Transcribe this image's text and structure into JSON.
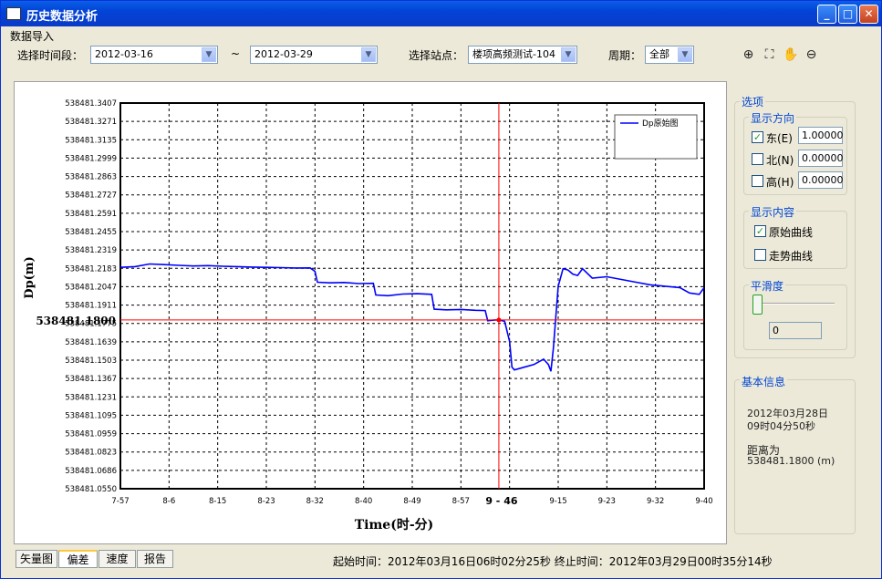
{
  "window": {
    "title": "历史数据分析"
  },
  "menu": {
    "data_import": "数据导入"
  },
  "toolbar": {
    "time_range_label": "选择时间段：",
    "start_date": "2012-03-16",
    "tilde": "~",
    "end_date": "2012-03-29",
    "station_label": "选择站点：",
    "station_value": "楼项高频测试-104",
    "period_label": "周期：",
    "period_value": "全部"
  },
  "options": {
    "title": "选项",
    "direction": {
      "title": "显示方向",
      "east": {
        "label": "东(E)",
        "checked": true,
        "value": "1.00000"
      },
      "north": {
        "label": "北(N)",
        "checked": false,
        "value": "0.00000"
      },
      "height": {
        "label": "高(H)",
        "checked": false,
        "value": "0.00000"
      }
    },
    "content": {
      "title": "显示内容",
      "raw": {
        "label": "原始曲线",
        "checked": true
      },
      "trend": {
        "label": "走势曲线",
        "checked": false
      }
    },
    "smoothing": {
      "title": "平滑度",
      "value": "0",
      "level": 0
    }
  },
  "basic_info": {
    "title": "基本信息",
    "date": "2012年03月28日",
    "time": "09时04分50秒",
    "distance_label": "距离为",
    "distance_value": "538481.1800 (m)"
  },
  "tabs": [
    "矢量图",
    "偏差",
    "速度",
    "报告"
  ],
  "active_tab": 1,
  "status": {
    "text": "起始时间：2012年03月16日06时02分25秒   终止时间：2012年03月29日00时35分14秒"
  },
  "chart_data": {
    "type": "line",
    "xlabel": "Time(时-分)",
    "ylabel": "Dp(m)",
    "yticks": [
      "538481.3407",
      "538481.3271",
      "538481.3135",
      "538481.2999",
      "538481.2863",
      "538481.2727",
      "538481.2591",
      "538481.2455",
      "538481.2319",
      "538481.2183",
      "538481.2047",
      "538481.1911",
      "538481.1775",
      "538481.1639",
      "538481.1503",
      "538481.1367",
      "538481.1231",
      "538481.1095",
      "538481.0959",
      "538481.0823",
      "538481.0686",
      "538481.0550"
    ],
    "xticks": [
      "7-57",
      "8-6",
      "8-15",
      "8-23",
      "8-32",
      "8-40",
      "8-49",
      "8-57",
      "9-4",
      "9-15",
      "9-23",
      "9-32",
      "9-40"
    ],
    "ylim": [
      538481.055,
      538481.3407
    ],
    "legend": "Dp原始图",
    "cursor": {
      "x_index": 7.78,
      "y": 538481.18,
      "y_label": "538481.1800",
      "x_label": "9 - 46"
    },
    "series": [
      {
        "name": "Dp原始图",
        "x": [
          0,
          0.3,
          0.6,
          0.9,
          1.2,
          1.5,
          1.8,
          2.1,
          2.4,
          2.7,
          3.0,
          3.3,
          3.6,
          3.9,
          4.0,
          4.05,
          4.3,
          4.6,
          4.9,
          5.2,
          5.25,
          5.5,
          5.8,
          6.1,
          6.4,
          6.45,
          6.7,
          7.0,
          7.3,
          7.5,
          7.55,
          7.7,
          7.78,
          7.9,
          8.0,
          8.05,
          8.1,
          8.3,
          8.5,
          8.7,
          8.8,
          8.85,
          8.9,
          9.0,
          9.1,
          9.2,
          9.3,
          9.4,
          9.5,
          9.7,
          10.0,
          10.3,
          10.6,
          10.9,
          11.2,
          11.5,
          11.7,
          11.9,
          12.0
        ],
        "y": [
          538481.219,
          538481.2195,
          538481.2215,
          538481.221,
          538481.2205,
          538481.22,
          538481.2203,
          538481.2198,
          538481.2195,
          538481.2192,
          538481.219,
          538481.2188,
          538481.2185,
          538481.2186,
          538481.216,
          538481.208,
          538481.2075,
          538481.2078,
          538481.207,
          538481.2072,
          538481.1985,
          538481.198,
          538481.1992,
          538481.1995,
          538481.199,
          538481.188,
          538481.1875,
          538481.1878,
          538481.1872,
          538481.187,
          538481.1795,
          538481.18,
          538481.18,
          538481.179,
          538481.164,
          538481.145,
          538481.143,
          538481.145,
          538481.147,
          538481.151,
          538481.147,
          538481.142,
          538481.159,
          538481.205,
          538481.218,
          538481.217,
          538481.214,
          538481.213,
          538481.218,
          538481.211,
          538481.212,
          538481.21,
          538481.208,
          538481.206,
          538481.205,
          538481.204,
          538481.2,
          538481.199,
          538481.204
        ]
      }
    ]
  },
  "colors": {
    "title_bar": "#0a5fe8",
    "series": "#0000ff",
    "cursor": "#ff0000",
    "group_title": "#0046d5"
  }
}
